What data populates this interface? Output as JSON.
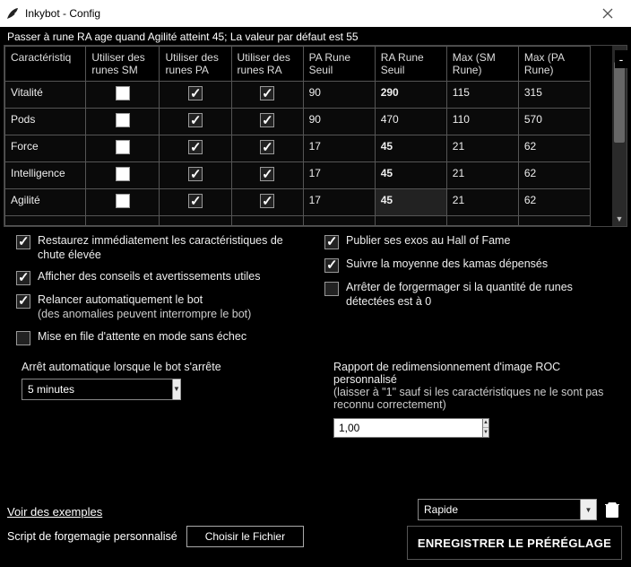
{
  "window": {
    "title": "Inkybot - Config",
    "notice": "Passer à rune RA age quand Agilité atteint 45; La valeur par défaut est 55"
  },
  "table": {
    "headers": [
      "Caractéristiq",
      "Utiliser des runes SM",
      "Utiliser des runes PA",
      "Utiliser des runes RA",
      "PA Rune Seuil",
      "RA Rune Seuil",
      "Max (SM Rune)",
      "Max (PA Rune)"
    ],
    "rows": [
      {
        "stat": "Vitalité",
        "sm": false,
        "pa": true,
        "ra": true,
        "paSeuil": "90",
        "raSeuil": "290",
        "raBold": true,
        "maxSM": "115",
        "maxPA": "315"
      },
      {
        "stat": "Pods",
        "sm": false,
        "pa": true,
        "ra": true,
        "paSeuil": "90",
        "raSeuil": "470",
        "raBold": false,
        "maxSM": "110",
        "maxPA": "570"
      },
      {
        "stat": "Force",
        "sm": false,
        "pa": true,
        "ra": true,
        "paSeuil": "17",
        "raSeuil": "45",
        "raBold": true,
        "maxSM": "21",
        "maxPA": "62"
      },
      {
        "stat": "Intelligence",
        "sm": false,
        "pa": true,
        "ra": true,
        "paSeuil": "17",
        "raSeuil": "45",
        "raBold": true,
        "maxSM": "21",
        "maxPA": "62"
      },
      {
        "stat": "Agilité",
        "sm": false,
        "pa": true,
        "ra": true,
        "paSeuil": "17",
        "raSeuil": "45",
        "raBold": true,
        "raDim": true,
        "maxSM": "21",
        "maxPA": "62"
      }
    ]
  },
  "options": {
    "left": [
      {
        "checked": true,
        "label": "Restaurez immédiatement les caractéristiques de chute élevée"
      },
      {
        "checked": true,
        "label": "Afficher des conseils et avertissements utiles"
      },
      {
        "checked": true,
        "label": "Relancer automatiquement le bot",
        "sub": "(des anomalies peuvent interrompre le bot)"
      },
      {
        "checked": false,
        "label": "Mise en file d'attente en mode sans échec"
      }
    ],
    "right": [
      {
        "checked": true,
        "label": "Publier ses exos au Hall of Fame"
      },
      {
        "checked": true,
        "label": "Suivre la moyenne des kamas dépensés"
      },
      {
        "checked": false,
        "label": "Arrêter de forgermager si la quantité de runes détectées est à 0"
      }
    ]
  },
  "autoStop": {
    "label": "Arrêt automatique lorsque le bot s'arrête",
    "value": "5 minutes"
  },
  "roc": {
    "label": "Rapport de redimensionnement d'image ROC personnalisé",
    "hint": "(laisser à \"1\" sauf si les caractéristiques ne le sont pas reconnu correctement)",
    "value": "1,00"
  },
  "bottom": {
    "examples_link": "Voir des exemples",
    "script_label": "Script de forgemagie personnalisé",
    "choose_btn": "Choisir le Fichier",
    "preset_value": "Rapide",
    "save_btn": "ENREGISTRER LE PRÉRÉGLAGE"
  }
}
